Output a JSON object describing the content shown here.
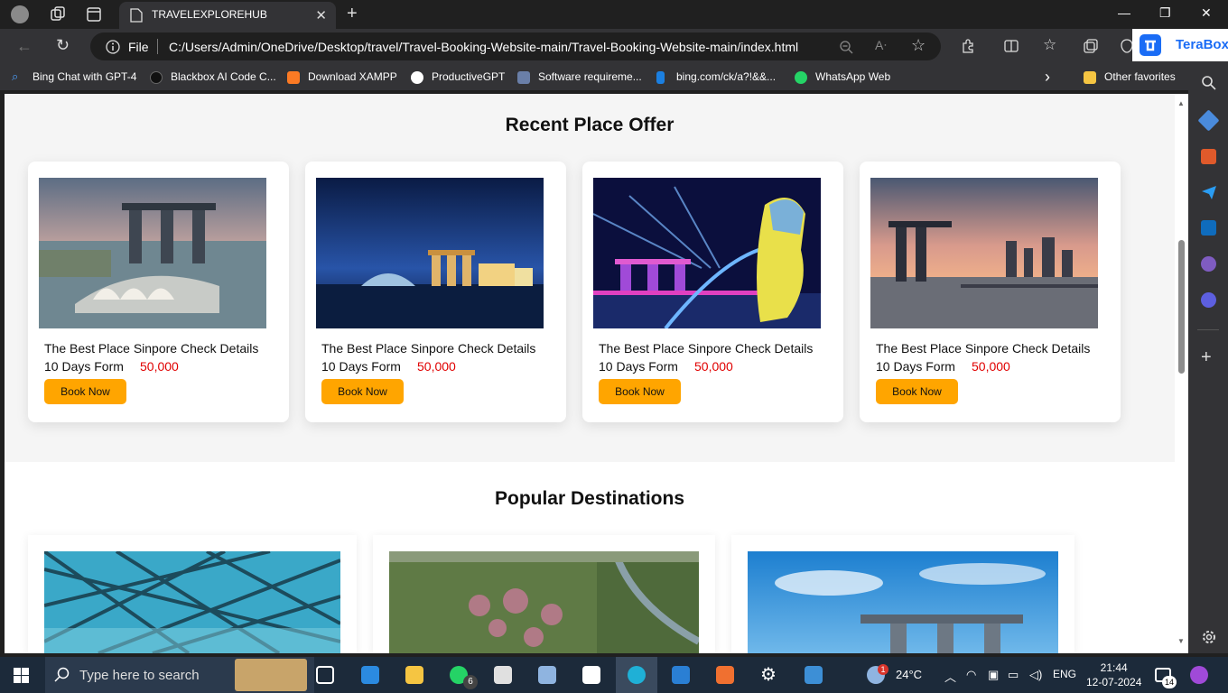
{
  "browser": {
    "tab_title": "TRAVELEXPLOREHUB",
    "tab_close": "✕",
    "new_tab": "+",
    "address_scheme": "File",
    "address_url": "C:/Users/Admin/OneDrive/Desktop/travel/Travel-Booking-Website-main/Travel-Booking-Website-main/index.html",
    "extension_name": "TeraBox",
    "window_controls": [
      "—",
      "❐",
      "✕"
    ]
  },
  "favorites": [
    {
      "label": "Bing Chat with GPT-4",
      "icon": "search-icon"
    },
    {
      "label": "Blackbox AI Code C...",
      "icon": "blackbox-icon"
    },
    {
      "label": "Download XAMPP",
      "icon": "xampp-icon"
    },
    {
      "label": "ProductiveGPT",
      "icon": "productivegpt-icon"
    },
    {
      "label": "Software requireme...",
      "icon": "document-icon"
    },
    {
      "label": "bing.com/ck/a?!&&...",
      "icon": "bing-icon"
    },
    {
      "label": "WhatsApp Web",
      "icon": "whatsapp-icon"
    }
  ],
  "favorites_more": "›",
  "other_favorites": "Other favorites",
  "page": {
    "offers_title": "Recent Place Offer",
    "offers": [
      {
        "name": "The Best Place Sinpore Check Details",
        "days": "10 Days Form",
        "price": "50,000",
        "button": "Book Now"
      },
      {
        "name": "The Best Place Sinpore Check Details",
        "days": "10 Days Form",
        "price": "50,000",
        "button": "Book Now"
      },
      {
        "name": "The Best Place Sinpore Check Details",
        "days": "10 Days Form",
        "price": "50,000",
        "button": "Book Now"
      },
      {
        "name": "The Best Place Sinpore Check Details",
        "days": "10 Days Form",
        "price": "50,000",
        "button": "Book Now"
      }
    ],
    "popular_title": "Popular Destinations"
  },
  "taskbar": {
    "search_placeholder": "Type here to search",
    "whatsapp_badge": "6",
    "weather_badge": "1",
    "temperature": "24°C",
    "language": "ENG",
    "time": "21:44",
    "date": "12-07-2024",
    "notification_count": "14"
  }
}
